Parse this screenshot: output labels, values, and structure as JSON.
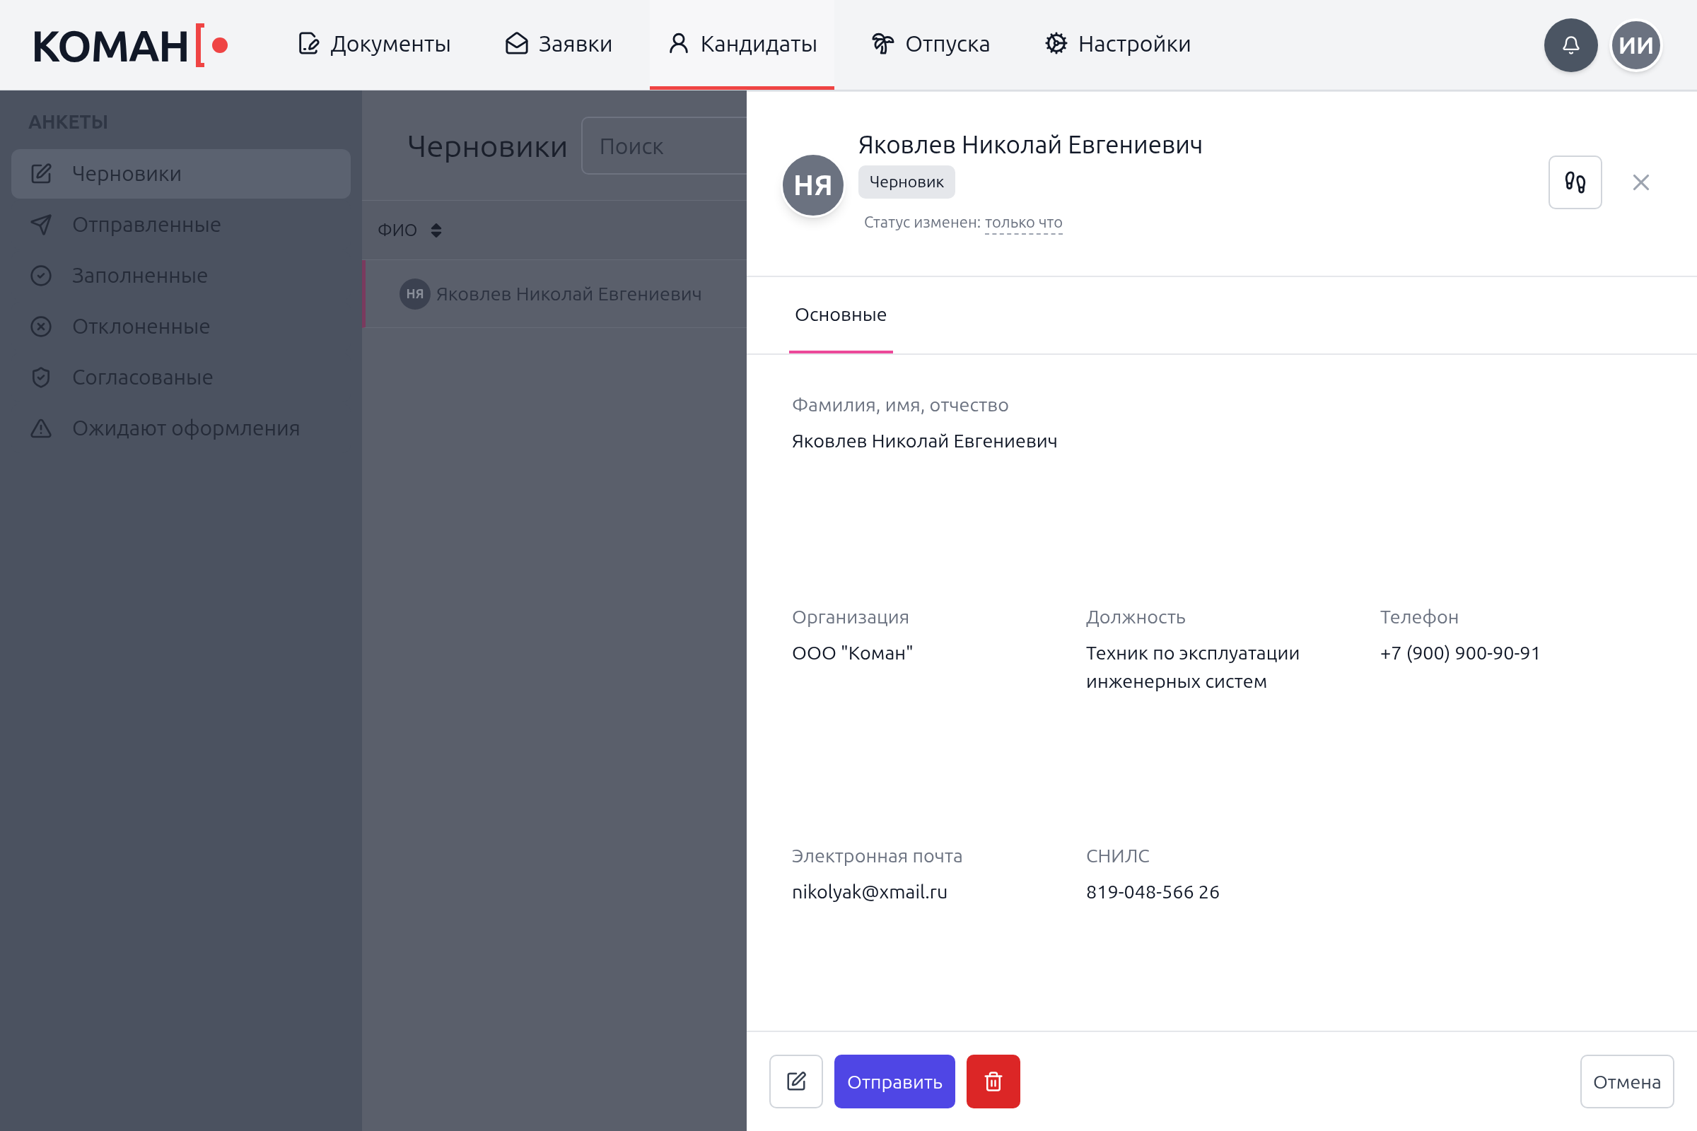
{
  "header": {
    "logo": "КОМАН",
    "nav": [
      {
        "label": "Документы",
        "selected": false
      },
      {
        "label": "Заявки",
        "selected": false
      },
      {
        "label": "Кандидаты",
        "selected": true
      },
      {
        "label": "Отпуска",
        "selected": false
      },
      {
        "label": "Настройки",
        "selected": false
      }
    ],
    "user_avatar": "ИИ"
  },
  "sidebar": {
    "section_title": "АНКЕТЫ",
    "items": [
      {
        "label": "Черновики",
        "selected": true
      },
      {
        "label": "Отправленные",
        "selected": false
      },
      {
        "label": "Заполненные",
        "selected": false
      },
      {
        "label": "Отклоненные",
        "selected": false
      },
      {
        "label": "Согласованые",
        "selected": false
      },
      {
        "label": "Ожидают оформления",
        "selected": false
      }
    ]
  },
  "list": {
    "title": "Черновики",
    "search": {
      "placeholder": "Поиск"
    },
    "column": "ФИО",
    "rows": [
      {
        "initials": "НЯ",
        "name": "Яковлев Николай Евгениевич",
        "selected": true
      }
    ]
  },
  "panel": {
    "initials": "НЯ",
    "name": "Яковлев Николай Евгениевич",
    "badge": "Черновик",
    "status_label": "Статус изменен:",
    "status_time": "только что",
    "tabs": [
      {
        "label": "Основные",
        "selected": true
      }
    ],
    "field_rows": [
      [
        {
          "label": "Фамилия, имя, отчество",
          "value": "Яковлев Николай Евгениевич"
        }
      ],
      [
        {
          "label": "Организация",
          "value": "ООО \"Коман\""
        },
        {
          "label": "Должность",
          "value": "Техник по эксплуатации инженерных систем"
        },
        {
          "label": "Телефон",
          "value": "+7 (900) 900-90-91"
        }
      ],
      [
        {
          "label": "Электронная почта",
          "value": "nikolyak@xmail.ru"
        },
        {
          "label": "СНИЛС",
          "value": "819-048-566 26"
        }
      ]
    ],
    "send_button": "Отправить",
    "cancel_button": "Отмена"
  }
}
